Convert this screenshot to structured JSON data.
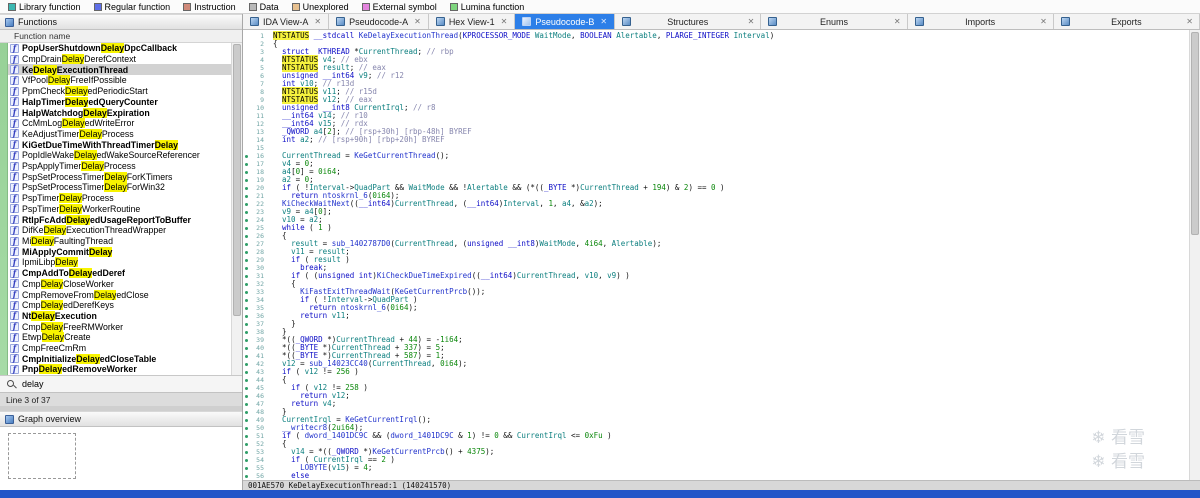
{
  "legend": {
    "items": [
      {
        "label": "Library function",
        "color": "#3cb8b2"
      },
      {
        "label": "Regular function",
        "color": "#5f6fe8"
      },
      {
        "label": "Instruction",
        "color": "#d08a7a"
      },
      {
        "label": "Data",
        "color": "#b9b9b9"
      },
      {
        "label": "Unexplored",
        "color": "#e7c08f"
      },
      {
        "label": "External symbol",
        "color": "#e383dd"
      },
      {
        "label": "Lumina function",
        "color": "#7fd67f"
      }
    ]
  },
  "tabs": {
    "items": [
      {
        "label": "IDA View-A"
      },
      {
        "label": "Pseudocode-A"
      },
      {
        "label": "Hex View-1"
      },
      {
        "label": "Pseudocode-B",
        "active": true
      },
      {
        "label": "Structures",
        "wide": true
      },
      {
        "label": "Enums",
        "wide": true
      },
      {
        "label": "Imports",
        "wide": true
      },
      {
        "label": "Exports",
        "wide": true
      }
    ]
  },
  "functions_panel": {
    "title": "Functions",
    "column_header": "Function name",
    "filter": {
      "query": "delay"
    },
    "status": "Line 3 of 37",
    "items": [
      {
        "name": "PopUserShutdownDelayDpcCallback",
        "bold": true
      },
      {
        "name": "CmpDrainDelayDerefContext"
      },
      {
        "name": "KeDelayExecutionThread",
        "bold": true,
        "selected": true
      },
      {
        "name": "VfPoolDelayFreeIfPossible"
      },
      {
        "name": "PpmCheckDelayedPeriodicStart"
      },
      {
        "name": "HalpTimerDelayedQueryCounter",
        "bold": true
      },
      {
        "name": "HalpWatchdogDelayExpiration",
        "bold": true
      },
      {
        "name": "CcMmLogDelayedWriteError"
      },
      {
        "name": "KeAdjustTimerDelayProcess"
      },
      {
        "name": "KiGetDueTimeWithThreadTimerDelay",
        "bold": true
      },
      {
        "name": "PopIdleWakeDelayedWakeSourceReferencer"
      },
      {
        "name": "PspApplyTimerDelayProcess"
      },
      {
        "name": "PspSetProcessTimerDelayForKTimers"
      },
      {
        "name": "PspSetProcessTimerDelayForWin32"
      },
      {
        "name": "PspTimerDelayProcess"
      },
      {
        "name": "PspTimerDelayWorkerRoutine"
      },
      {
        "name": "RtlpFcAddDelayedUsageReportToBuffer",
        "bold": true
      },
      {
        "name": "DifKeDelayExecutionThreadWrapper"
      },
      {
        "name": "MiDelayFaultingThread"
      },
      {
        "name": "MiApplyCommitDelay",
        "bold": true
      },
      {
        "name": "IpmiLibpDelay"
      },
      {
        "name": "CmpAddToDelayedDeref",
        "bold": true
      },
      {
        "name": "CmpDelayCloseWorker"
      },
      {
        "name": "CmpRemoveFromDelayedClose"
      },
      {
        "name": "CmpDelayedDerefKeys"
      },
      {
        "name": "NtDelayExecution",
        "bold": true
      },
      {
        "name": "CmpDelayFreeRMWorker"
      },
      {
        "name": "EtwpDelayCreate"
      },
      {
        "name": "CmpFreeCmRm"
      },
      {
        "name": "CmpInitializeDelayedCloseTable",
        "bold": true
      },
      {
        "name": "PnpDelayedRemoveWorker",
        "bold": true
      }
    ]
  },
  "graph_overview": {
    "title": "Graph overview"
  },
  "code": {
    "highlight_token": "NTSTATUS",
    "keywords": [
      "struct",
      "unsigned",
      "int",
      "if",
      "return",
      "while",
      "break",
      "else",
      "__stdcall",
      "__int64",
      "__int8",
      "BOOLEAN",
      "KPROCESSOR_MODE",
      "PLARGE_INTEGER",
      "_KTHREAD",
      "_QWORD",
      "_BYTE"
    ],
    "locals": [
      "CurrentThread",
      "CurrentIrql",
      "WaitMode",
      "Alertable",
      "Interval",
      "QuadPart",
      "result",
      "v4",
      "v9",
      "v10",
      "v11",
      "v12",
      "v14",
      "v15",
      "a4",
      "a2"
    ],
    "lines": [
      "NTSTATUS __stdcall KeDelayExecutionThread(KPROCESSOR_MODE WaitMode, BOOLEAN Alertable, PLARGE_INTEGER Interval)",
      "{",
      "  struct _KTHREAD *CurrentThread; // rbp",
      "  NTSTATUS v4; // ebx",
      "  NTSTATUS result; // eax",
      "  unsigned __int64 v9; // r12",
      "  int v10; // r13d",
      "  NTSTATUS v11; // r15d",
      "  NTSTATUS v12; // eax",
      "  unsigned __int8 CurrentIrql; // r8",
      "  __int64 v14; // r10",
      "  __int64 v15; // rdx",
      "  _QWORD a4[2]; // [rsp+30h] [rbp-48h] BYREF",
      "  int a2; // [rsp+90h] [rbp+20h] BYREF",
      "",
      "  CurrentThread = KeGetCurrentThread();",
      "  v4 = 0;",
      "  a4[0] = 0i64;",
      "  a2 = 0;",
      "  if ( !Interval->QuadPart && WaitMode && !Alertable && (*((_BYTE *)CurrentThread + 194) & 2) == 0 )",
      "    return ntoskrnl_6(0i64);",
      "  KiCheckWaitNext((__int64)CurrentThread, (__int64)Interval, 1, a4, &a2);",
      "  v9 = a4[0];",
      "  v10 = a2;",
      "  while ( 1 )",
      "  {",
      "    result = sub_1402787D0(CurrentThread, (unsigned __int8)WaitMode, 4i64, Alertable);",
      "    v11 = result;",
      "    if ( result )",
      "      break;",
      "    if ( (unsigned int)KiCheckDueTimeExpired((__int64)CurrentThread, v10, v9) )",
      "    {",
      "      KiFastExitThreadWait(KeGetCurrentPrcb());",
      "      if ( !Interval->QuadPart )",
      "        return ntoskrnl_6(0i64);",
      "      return v11;",
      "    }",
      "  }",
      "  *((_QWORD *)CurrentThread + 44) = -1i64;",
      "  *((_BYTE *)CurrentThread + 337) = 5;",
      "  *((_BYTE *)CurrentThread + 587) = 1;",
      "  v12 = sub_14023CC40(CurrentThread, 0i64);",
      "  if ( v12 != 256 )",
      "  {",
      "    if ( v12 != 258 )",
      "      return v12;",
      "    return v4;",
      "  }",
      "  CurrentIrql = KeGetCurrentIrql();",
      "  __writecr8(2ui64);",
      "  if ( dword_1401DC9C && (dword_1401DC9C & 1) != 0 && CurrentIrql <= 0xFu )",
      "  {",
      "    v14 = *((_QWORD *)KeGetCurrentPrcb() + 4375);",
      "    if ( CurrentIrql == 2 )",
      "      LOBYTE(v15) = 4;",
      "    else"
    ]
  },
  "status_bar": {
    "text": "001AE570 KeDelayExecutionThread:1 (140241570)"
  },
  "icons": {
    "close": "✕",
    "function_glyph": "f",
    "snowflake": "❄"
  },
  "watermark": {
    "text": "看雪"
  }
}
